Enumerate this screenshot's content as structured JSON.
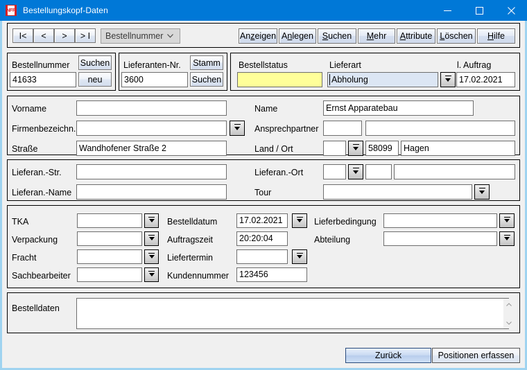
{
  "window": {
    "title": "Bestellungskopf-Daten",
    "icon_glyph": "NFR",
    "icon_name": "app-icon",
    "minimize_label": "–",
    "maximize_label": "□",
    "close_label": "✕",
    "titlebar_color": "#0078d7",
    "border_color": "#9fd3f0"
  },
  "toolbar": {
    "nav": [
      {
        "label": "I<",
        "name": "nav-first"
      },
      {
        "label": "<",
        "name": "nav-prev"
      },
      {
        "label": ">",
        "name": "nav-next"
      },
      {
        "label": "> I",
        "name": "nav-last"
      }
    ],
    "combo": {
      "value": "Bestellnummer",
      "options": [
        "Bestellnummer"
      ]
    },
    "actions": [
      {
        "pre": "An",
        "mn": "z",
        "post": "eigen",
        "name": "anzeigen"
      },
      {
        "pre": "A",
        "mn": "n",
        "post": "legen",
        "name": "anlegen"
      },
      {
        "pre": "",
        "mn": "S",
        "post": "uchen",
        "name": "suchen"
      },
      {
        "pre": "",
        "mn": "M",
        "post": "ehr",
        "name": "mehr"
      },
      {
        "pre": "",
        "mn": "A",
        "post": "ttribute",
        "name": "attribute"
      },
      {
        "pre": "",
        "mn": "L",
        "post": "öschen",
        "name": "loeschen"
      },
      {
        "pre": "",
        "mn": "H",
        "post": "ilfe",
        "name": "hilfe"
      }
    ]
  },
  "header_row": {
    "bestellnummer": {
      "label": "Bestellnummer",
      "value": "41633",
      "search_button": "Suchen",
      "new_button": "neu"
    },
    "lieferanten_nr": {
      "label": "Lieferanten-Nr.",
      "value": "3600",
      "stamm_button": "Stamm",
      "search_button": "Suchen"
    },
    "bestellstatus": {
      "label": "Bestellstatus",
      "value": "",
      "field_color": "#ffff99"
    },
    "lieferart": {
      "label": "Lieferart",
      "value": "Abholung",
      "field_color": "#dce6f4"
    },
    "l_auftrag": {
      "label": "l. Auftrag",
      "value": "17.02.2021"
    }
  },
  "address_section": {
    "vorname": {
      "label": "Vorname",
      "value": ""
    },
    "firmenbezeichn": {
      "label": "Firmenbezeichn.",
      "value": ""
    },
    "strasse": {
      "label": "Straße",
      "value": "Wandhofener Straße 2"
    },
    "name": {
      "label": "Name",
      "value": "Ernst Apparatebau"
    },
    "ansprechpartner": {
      "label": "Ansprechpartner",
      "value_short": "",
      "value_long": ""
    },
    "land_ort": {
      "label": "Land / Ort",
      "land": "",
      "plz": "58099",
      "ort": "Hagen"
    }
  },
  "delivery_section": {
    "lieferan_str": {
      "label": "Lieferan.-Str.",
      "value": ""
    },
    "lieferan_name": {
      "label": "Lieferan.-Name",
      "value": ""
    },
    "lieferan_ort": {
      "label": "Lieferan.-Ort",
      "land": "",
      "plz": "",
      "ort": ""
    },
    "tour": {
      "label": "Tour",
      "value": ""
    }
  },
  "detail_section": {
    "tka": {
      "label": "TKA",
      "value": ""
    },
    "verpackung": {
      "label": "Verpackung",
      "value": ""
    },
    "fracht": {
      "label": "Fracht",
      "value": ""
    },
    "sachbearbeiter": {
      "label": "Sachbearbeiter",
      "value": ""
    },
    "bestelldatum": {
      "label": "Bestelldatum",
      "value": "17.02.2021"
    },
    "auftragszeit": {
      "label": "Auftragszeit",
      "value": "20:20:04"
    },
    "liefertermin": {
      "label": "Liefertermin",
      "value": ""
    },
    "kundennummer": {
      "label": "Kundennummer",
      "value": "123456"
    },
    "lieferbedingung": {
      "label": "Lieferbedingung",
      "value": ""
    },
    "abteilung": {
      "label": "Abteilung",
      "value": ""
    }
  },
  "notes_section": {
    "label": "Bestelldaten",
    "value": ""
  },
  "footer": {
    "back_button": "Zurück",
    "positions_button": "Positionen erfassen"
  }
}
